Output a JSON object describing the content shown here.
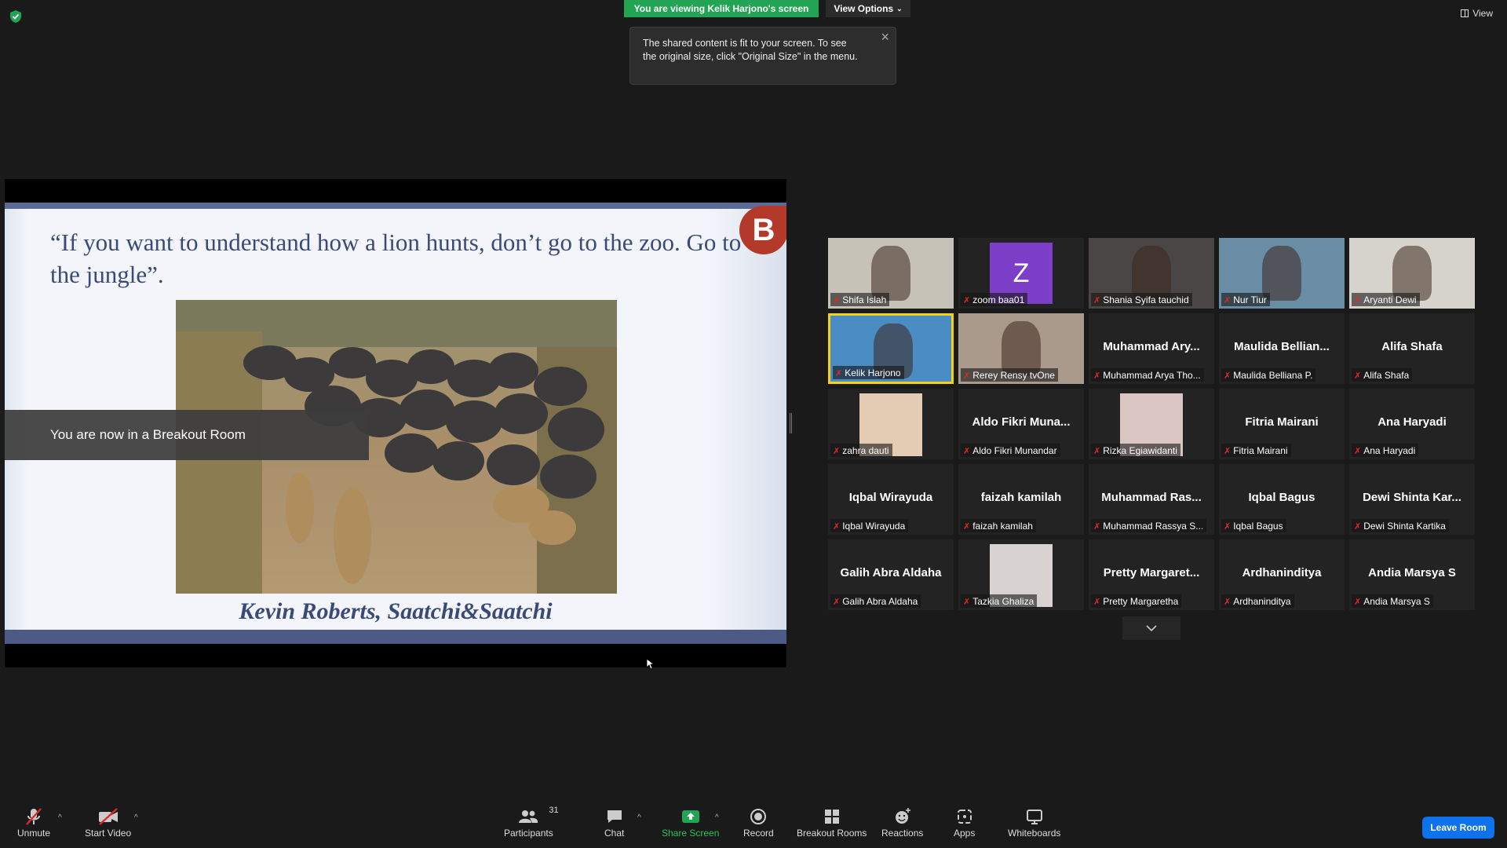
{
  "top": {
    "viewing_banner": "You are viewing Kelik Harjono's screen",
    "view_options": "View Options",
    "view": "View"
  },
  "tooltip": {
    "text": "The shared content is fit to your screen. To see the original size, click \"Original Size\" in the menu."
  },
  "slide": {
    "quote": "“If you want to understand how a lion hunts, don’t go to the zoo. Go to the jungle”.",
    "author": "Kevin Roberts, Saatchi&Saatchi",
    "logo_letter": "B"
  },
  "breakout_toast": "You are now in a Breakout Room",
  "participants": [
    {
      "name": "Shifa Islah",
      "video": true,
      "bg": "#c7c2b8"
    },
    {
      "name": "zoom baa01",
      "avatar": "Z",
      "avatar_color": "#7d3fc8"
    },
    {
      "name": "Shania Syifa tauchid",
      "video": true,
      "bg": "#4a4645"
    },
    {
      "name": "Nur Tiur",
      "video": true,
      "bg": "#6a8da6"
    },
    {
      "name": "Aryanti Dewi",
      "video": true,
      "bg": "#d6d2cc"
    },
    {
      "name": "Kelik Harjono",
      "video": true,
      "bg": "#4a8dc4",
      "active": true
    },
    {
      "name": "Rerey Rensy tvOne",
      "video": true,
      "bg": "#a99a8c"
    },
    {
      "name": "Muhammad Arya Tho...",
      "big_name": "Muhammad Ary..."
    },
    {
      "name": "Maulida Belliana P.",
      "big_name": "Maulida Bellian..."
    },
    {
      "name": "Alifa Shafa",
      "big_name": "Alifa Shafa"
    },
    {
      "name": "zahra dauti",
      "thumb_color": "#e3cbb4"
    },
    {
      "name": "Aldo Fikri Munandar",
      "big_name": "Aldo Fikri Muna..."
    },
    {
      "name": "Rizka Egiawidanti",
      "thumb_color": "#d9c6c3"
    },
    {
      "name": "Fitria Mairani",
      "big_name": "Fitria Mairani"
    },
    {
      "name": "Ana Haryadi",
      "big_name": "Ana Haryadi"
    },
    {
      "name": "Iqbal Wirayuda",
      "big_name": "Iqbal Wirayuda"
    },
    {
      "name": "faizah kamilah",
      "big_name": "faizah kamilah"
    },
    {
      "name": "Muhammad Rassya S...",
      "big_name": "Muhammad Ras..."
    },
    {
      "name": "Iqbal Bagus",
      "big_name": "Iqbal Bagus"
    },
    {
      "name": "Dewi Shinta Kartika",
      "big_name": "Dewi Shinta Kar..."
    },
    {
      "name": "Galih Abra Aldaha",
      "big_name": "Galih Abra Aldaha"
    },
    {
      "name": "Tazkia Ghaliza",
      "thumb_color": "#d8d2d0"
    },
    {
      "name": "Pretty Margaretha",
      "big_name": "Pretty Margaret..."
    },
    {
      "name": "Ardhaninditya",
      "big_name": "Ardhaninditya"
    },
    {
      "name": "Andia Marsya S",
      "big_name": "Andia Marsya S"
    }
  ],
  "toolbar": {
    "unmute": "Unmute",
    "start_video": "Start Video",
    "participants": "Participants",
    "participants_count": "31",
    "chat": "Chat",
    "share_screen": "Share Screen",
    "record": "Record",
    "breakout_rooms": "Breakout Rooms",
    "reactions": "Reactions",
    "apps": "Apps",
    "whiteboards": "Whiteboards",
    "leave_room": "Leave Room"
  },
  "colors": {
    "green_banner": "#23a455",
    "leave_blue": "#0e72ed",
    "active_speaker": "#f5d311",
    "muted_red": "#e02828"
  }
}
